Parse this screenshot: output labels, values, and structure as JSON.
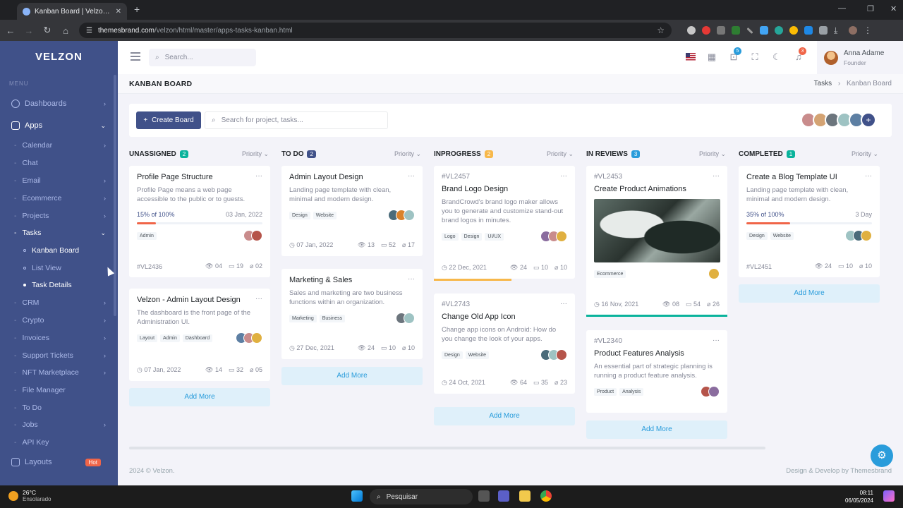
{
  "browser": {
    "tab_title": "Kanban Board | Velzon - Admin",
    "url_domain": "themesbrand.com",
    "url_path": "/velzon/html/master/apps-tasks-kanban.html"
  },
  "sidebar": {
    "logo": "velzon",
    "menu_title": "MENU",
    "items": [
      {
        "label": "Dashboards"
      },
      {
        "label": "Apps"
      },
      {
        "label": "Calendar"
      },
      {
        "label": "Chat"
      },
      {
        "label": "Email"
      },
      {
        "label": "Ecommerce"
      },
      {
        "label": "Projects"
      },
      {
        "label": "Tasks"
      },
      {
        "label": "Kanban Board"
      },
      {
        "label": "List View"
      },
      {
        "label": "Task Details"
      },
      {
        "label": "CRM"
      },
      {
        "label": "Crypto"
      },
      {
        "label": "Invoices"
      },
      {
        "label": "Support Tickets"
      },
      {
        "label": "NFT Marketplace"
      },
      {
        "label": "File Manager"
      },
      {
        "label": "To Do"
      },
      {
        "label": "Jobs"
      },
      {
        "label": "API Key"
      },
      {
        "label": "Layouts"
      }
    ],
    "hot_badge": "Hot"
  },
  "topbar": {
    "search_placeholder": "Search...",
    "cart_count": "5",
    "notif_count": "3",
    "user_name": "Anna Adame",
    "user_role": "Founder"
  },
  "page": {
    "title": "KANBAN BOARD",
    "crumb_1": "Tasks",
    "crumb_2": "Kanban Board"
  },
  "toolbar": {
    "create_label": "Create Board",
    "search_placeholder": "Search for project, tasks..."
  },
  "columns": [
    {
      "name": "UNASSIGNED",
      "count": "2",
      "color": "#0ab39c"
    },
    {
      "name": "TO DO",
      "count": "2",
      "color": "#405189"
    },
    {
      "name": "INPROGRESS",
      "count": "2",
      "color": "#f7b84b"
    },
    {
      "name": "IN REVIEWS",
      "count": "3",
      "color": "#299cdb"
    },
    {
      "name": "COMPLETED",
      "count": "1",
      "color": "#0ab39c"
    }
  ],
  "priority_label": "Priority",
  "add_more": "Add More",
  "cards": {
    "c1": {
      "title": "Profile Page Structure",
      "desc": "Profile Page means a web page accessible to the public or to guests.",
      "progress": "15% of 100%",
      "progress_pct": 15,
      "date": "03 Jan, 2022",
      "tags": [
        "Admin"
      ],
      "id": "#VL2436",
      "views": "04",
      "comments": "19",
      "files": "02"
    },
    "c2": {
      "title": "Velzon - Admin Layout Design",
      "desc": "The dashboard is the front page of the Administration UI.",
      "tags": [
        "Layout",
        "Admin",
        "Dashboard"
      ],
      "date": "07 Jan, 2022",
      "views": "14",
      "comments": "32",
      "files": "05"
    },
    "c3": {
      "title": "Admin Layout Design",
      "desc": "Landing page template with clean, minimal and modern design.",
      "tags": [
        "Design",
        "Website"
      ],
      "date": "07 Jan, 2022",
      "views": "13",
      "comments": "52",
      "files": "17"
    },
    "c4": {
      "title": "Marketing & Sales",
      "desc": "Sales and marketing are two business functions within an organization.",
      "tags": [
        "Marketing",
        "Business"
      ],
      "date": "27 Dec, 2021",
      "views": "24",
      "comments": "10",
      "files": "10"
    },
    "c5": {
      "id": "#VL2457",
      "title": "Brand Logo Design",
      "desc": "BrandCrowd's brand logo maker allows you to generate and customize stand-out brand logos in minutes.",
      "tags": [
        "Logo",
        "Design",
        "UI/UX"
      ],
      "date": "22 Dec, 2021",
      "views": "24",
      "comments": "10",
      "files": "10"
    },
    "c6": {
      "id": "#VL2743",
      "title": "Change Old App Icon",
      "desc": "Change app icons on Android: How do you change the look of your apps.",
      "tags": [
        "Design",
        "Website"
      ],
      "date": "24 Oct, 2021",
      "views": "64",
      "comments": "35",
      "files": "23"
    },
    "c7": {
      "id": "#VL2453",
      "title": "Create Product Animations",
      "tags": [
        "Ecommerce"
      ],
      "date": "16 Nov, 2021",
      "views": "08",
      "comments": "54",
      "files": "26"
    },
    "c8": {
      "id": "#VL2340",
      "title": "Product Features Analysis",
      "desc": "An essential part of strategic planning is running a product feature analysis.",
      "tags": [
        "Product",
        "Analysis"
      ]
    },
    "c9": {
      "title": "Create a Blog Template UI",
      "desc": "Landing page template with clean, minimal and modern design.",
      "progress": "35% of 100%",
      "progress_pct": 35,
      "date": "3 Day",
      "tags": [
        "Design",
        "Website"
      ],
      "id": "#VL2451",
      "views": "24",
      "comments": "10",
      "files": "10"
    }
  },
  "footer": {
    "left": "2024 © Velzon.",
    "right": "Design & Develop by Themesbrand"
  },
  "taskbar": {
    "temp": "26°C",
    "weather": "Ensolarado",
    "search": "Pesquisar",
    "time": "08:11",
    "date": "06/05/2024"
  },
  "colors": {
    "sidebar": "#405189",
    "primary": "#405189",
    "success": "#0ab39c",
    "warning": "#f7b84b",
    "info": "#299cdb",
    "danger": "#f06548"
  }
}
